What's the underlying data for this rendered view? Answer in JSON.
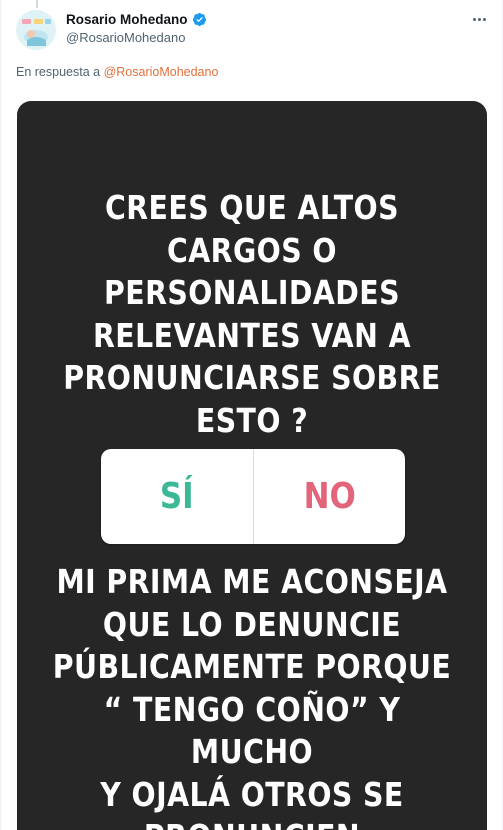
{
  "tweet": {
    "display_name": "Rosario Mohedano",
    "handle": "@RosarioMohedano",
    "verified": true,
    "reply_prefix": "En respuesta a",
    "reply_to": "@RosarioMohedano"
  },
  "story": {
    "question_lines": [
      "CREES QUE ALTOS",
      "CARGOS O",
      "PERSONALIDADES",
      "RELEVANTES VAN A",
      "PRONUNCIARSE SOBRE",
      "ESTO ?"
    ],
    "poll": {
      "option_yes": "SÍ",
      "option_no": "NO",
      "yes_color": "#3bb896",
      "no_color": "#e2657a"
    },
    "answer_lines": [
      "MI PRIMA ME ACONSEJA",
      "QUE LO DENUNCIE",
      "PÚBLICAMENTE PORQUE",
      "“ TENGO COÑO” Y MUCHO",
      "Y OJALÁ OTROS SE",
      "PRONUNCIEN"
    ]
  },
  "colors": {
    "story_background": "#262626",
    "mention": "#e0703c",
    "verified": "#1d9bf0"
  },
  "icons": {
    "verified": "verified-badge-icon",
    "more": "more-options-icon"
  }
}
